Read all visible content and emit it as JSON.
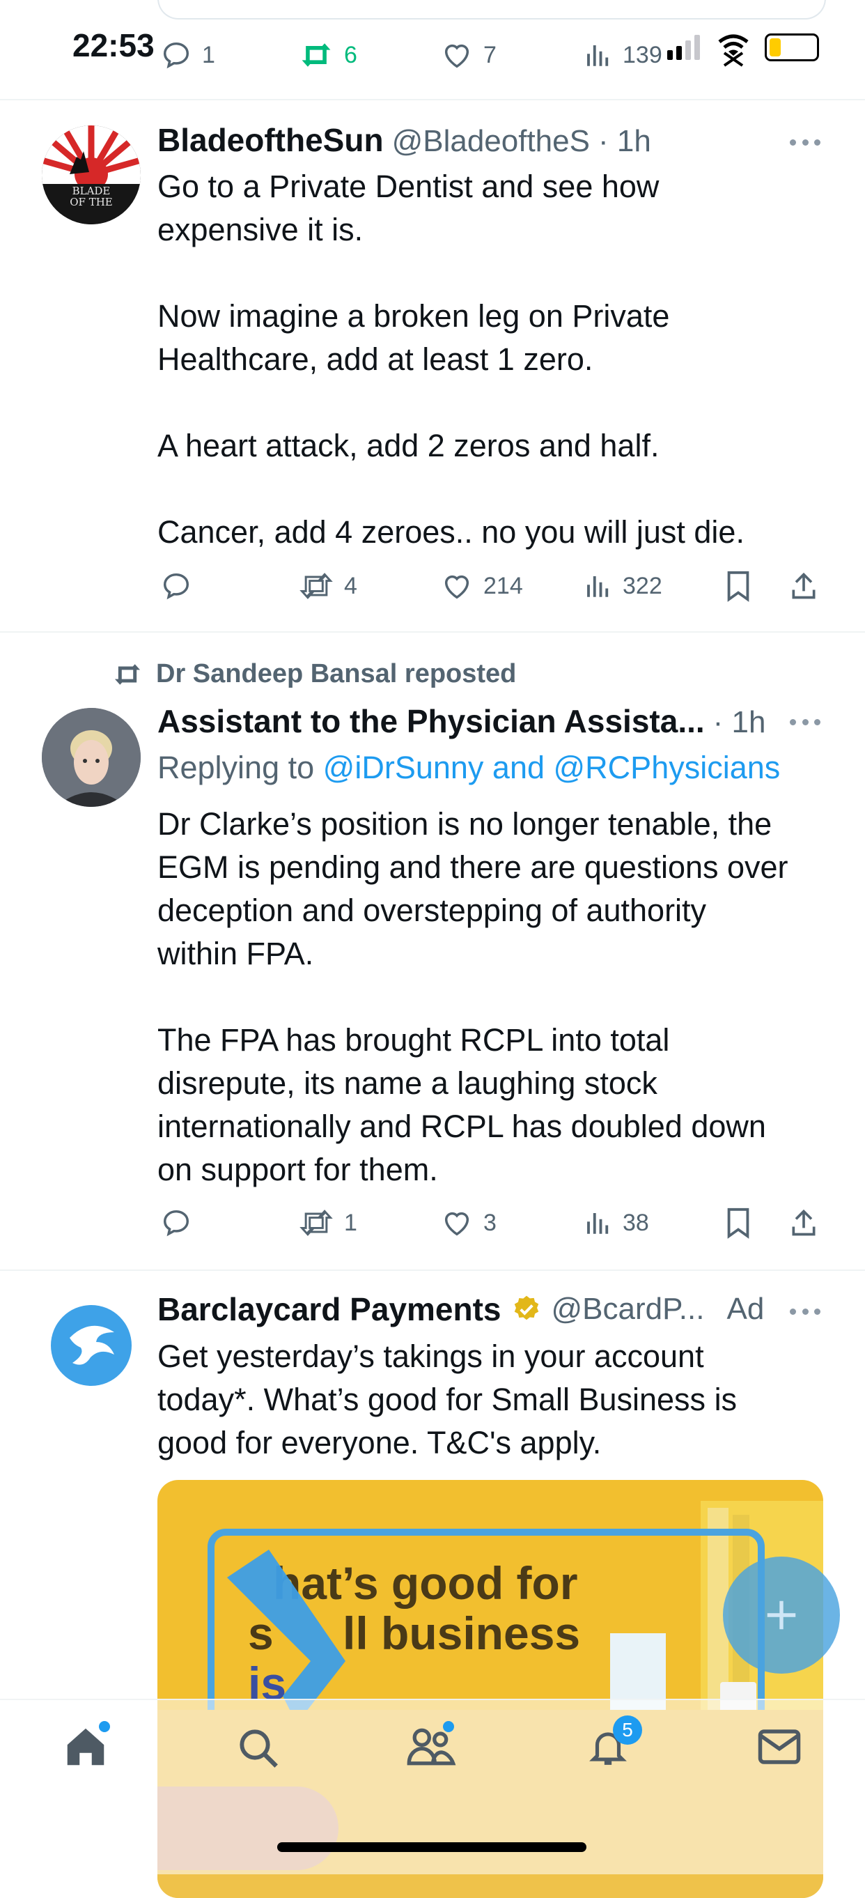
{
  "status_bar": {
    "time": "22:53"
  },
  "prev_tweet": {
    "replies": "1",
    "retweets": "6",
    "likes": "7",
    "views": "139"
  },
  "tweets": [
    {
      "name": "BladeoftheSun",
      "handle": "@BladeoftheS",
      "time": "· 1h",
      "avatar_text": "BLADE OF THE",
      "body": "Go to a Private Dentist and see how\nexpensive it is.\n\nNow imagine a broken leg on Private\nHealthcare, add at least 1 zero.\n\nA heart attack, add 2 zeros and half.\n\nCancer, add 4 zeroes.. no you will just die.",
      "retweets": "4",
      "likes": "214",
      "views": "322"
    },
    {
      "repost_label": "Dr Sandeep Bansal reposted",
      "name": "Assistant to the Physician Assista...",
      "time": "· 1h",
      "replying_prefix": "Replying to",
      "replying_to": "@iDrSunny and @RCPhysicians",
      "body": "Dr Clarke’s position is no longer tenable, the\nEGM is pending and there are questions over\ndeception and overstepping of authority\nwithin FPA.\n\nThe FPA has brought RCPL into total\ndisrepute, its name a laughing stock\ninternationally and RCPL has doubled down\non support for them.",
      "retweets": "1",
      "likes": "3",
      "views": "38"
    },
    {
      "name": "Barclaycard Payments",
      "handle": "@BcardP...",
      "ad_label": "Ad",
      "body": "Get yesterday’s takings in your account\ntoday*. What’s good for Small Business is\ngood for everyone. T&C's apply.",
      "ad_image_text_1": "hat’s good for",
      "ad_image_text_2": "s",
      "ad_image_text_3": "ll business",
      "ad_image_text_4": "is"
    }
  ],
  "bottom_nav": {
    "notifications_badge": "5"
  },
  "colors": {
    "accent": "#1d9bf0",
    "text": "#0f1419",
    "muted": "#536471",
    "retweet_green": "#00ba7c",
    "ad_yellow": "#f2bf2f"
  }
}
